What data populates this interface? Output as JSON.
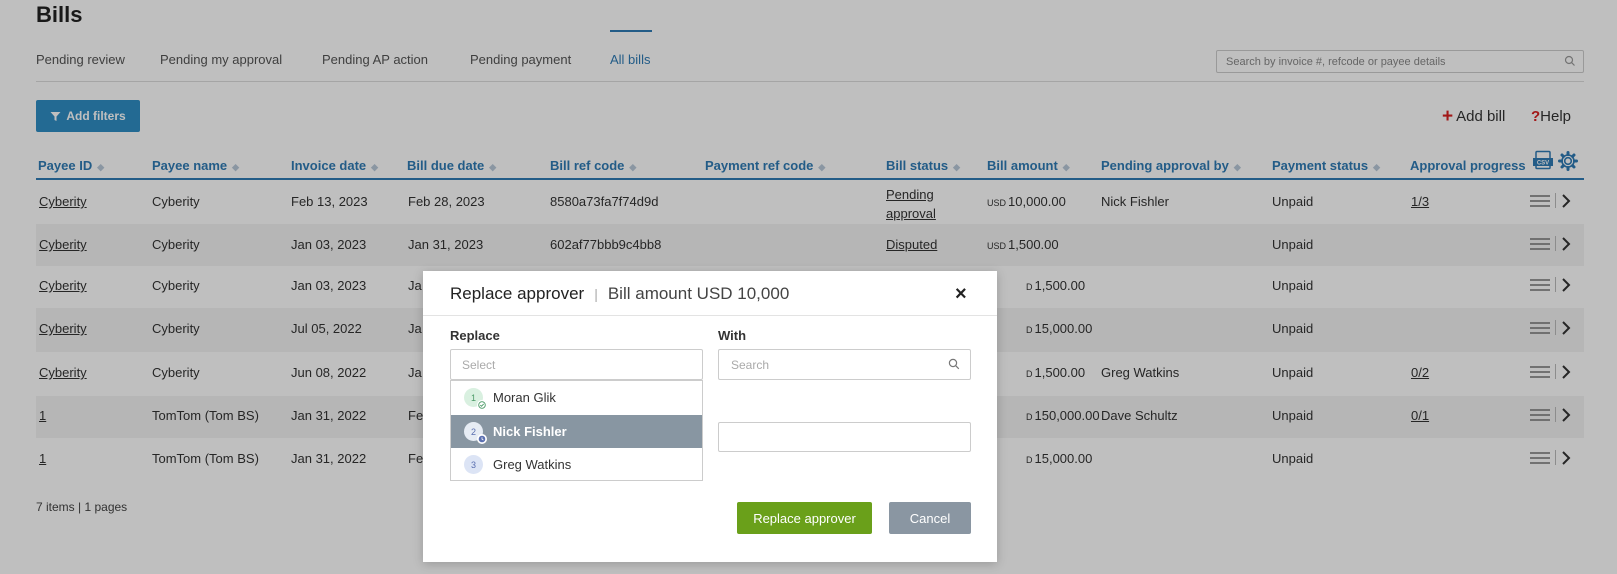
{
  "page_title": "Bills",
  "tabs": [
    {
      "label": "Pending review"
    },
    {
      "label": "Pending my approval"
    },
    {
      "label": "Pending AP action"
    },
    {
      "label": "Pending payment"
    },
    {
      "label": "All bills",
      "active": true
    }
  ],
  "search": {
    "placeholder": "Search by invoice #, refcode or payee details"
  },
  "toolbar": {
    "add_filters": "Add filters",
    "add_bill": "Add bill",
    "help_q": "?",
    "help": "Help"
  },
  "table": {
    "columns": [
      "Payee ID",
      "Payee name",
      "Invoice date",
      "Bill due date",
      "Bill ref code",
      "Payment ref code",
      "Bill status",
      "Bill amount",
      "Pending approval by",
      "Payment status",
      "Approval progress"
    ],
    "rows": [
      {
        "payee_id": "Cyberity",
        "payee_name": "Cyberity",
        "invoice_date": "Feb 13, 2023",
        "due_date": "Feb 28, 2023",
        "ref_code": "8580a73fa7f74d9d",
        "status": "Pending approval",
        "currency": "USD",
        "amount": "10,000.00",
        "pending_by": "Nick Fishler",
        "payment_status": "Unpaid",
        "progress": "1/3"
      },
      {
        "payee_id": "Cyberity",
        "payee_name": "Cyberity",
        "invoice_date": "Jan 03, 2023",
        "due_date": "Jan 31, 2023",
        "ref_code": "602af77bbb9c4bb8",
        "status": "Disputed",
        "currency": "USD",
        "amount": "1,500.00",
        "pending_by": "",
        "payment_status": "Unpaid",
        "progress": ""
      },
      {
        "payee_id": "Cyberity",
        "payee_name": "Cyberity",
        "invoice_date": "Jan 03, 2023",
        "due_date": "Ja",
        "amount": "1,500.00",
        "currency": "D",
        "payment_status": "Unpaid",
        "pending_by": "",
        "progress": ""
      },
      {
        "payee_id": "Cyberity",
        "payee_name": "Cyberity",
        "invoice_date": "Jul 05, 2022",
        "due_date": "Ja",
        "amount": "15,000.00",
        "currency": "D",
        "payment_status": "Unpaid",
        "pending_by": "",
        "progress": ""
      },
      {
        "payee_id": "Cyberity",
        "payee_name": "Cyberity",
        "invoice_date": "Jun 08, 2022",
        "due_date": "Ja",
        "amount": "1,500.00",
        "currency": "D",
        "payment_status": "Unpaid",
        "pending_by": "Greg Watkins",
        "progress": "0/2"
      },
      {
        "payee_id": "1",
        "payee_name": "TomTom (Tom BS)",
        "invoice_date": "Jan 31, 2022",
        "due_date": "Fe",
        "amount": "150,000.00",
        "currency": "D",
        "payment_status": "Unpaid",
        "pending_by": "Dave Schultz",
        "progress": "0/1"
      },
      {
        "payee_id": "1",
        "payee_name": "TomTom (Tom BS)",
        "invoice_date": "Jan 31, 2022",
        "due_date": "Fe",
        "amount": "15,000.00",
        "currency": "D",
        "payment_status": "Unpaid",
        "pending_by": "",
        "progress": ""
      }
    ]
  },
  "footer": {
    "summary": "7 items | 1 pages"
  },
  "modal": {
    "title": "Replace approver",
    "divider": "|",
    "subtitle": "Bill amount USD 10,000",
    "close": "×",
    "replace_label": "Replace",
    "replace_placeholder": "Select",
    "with_label": "With",
    "with_placeholder": "Search",
    "options": [
      {
        "num": "1",
        "name": "Moran Glik",
        "selected": false
      },
      {
        "num": "2",
        "name": "Nick Fishler",
        "selected": true
      },
      {
        "num": "3",
        "name": "Greg Watkins",
        "selected": false
      }
    ],
    "replace_button": "Replace approver",
    "cancel_button": "Cancel"
  },
  "colors": {
    "accent": "#2f7bb5",
    "primary_button": "#2f8ec4",
    "confirm": "#6aa01a",
    "cancel": "#8a96a2",
    "danger": "#d92020"
  }
}
